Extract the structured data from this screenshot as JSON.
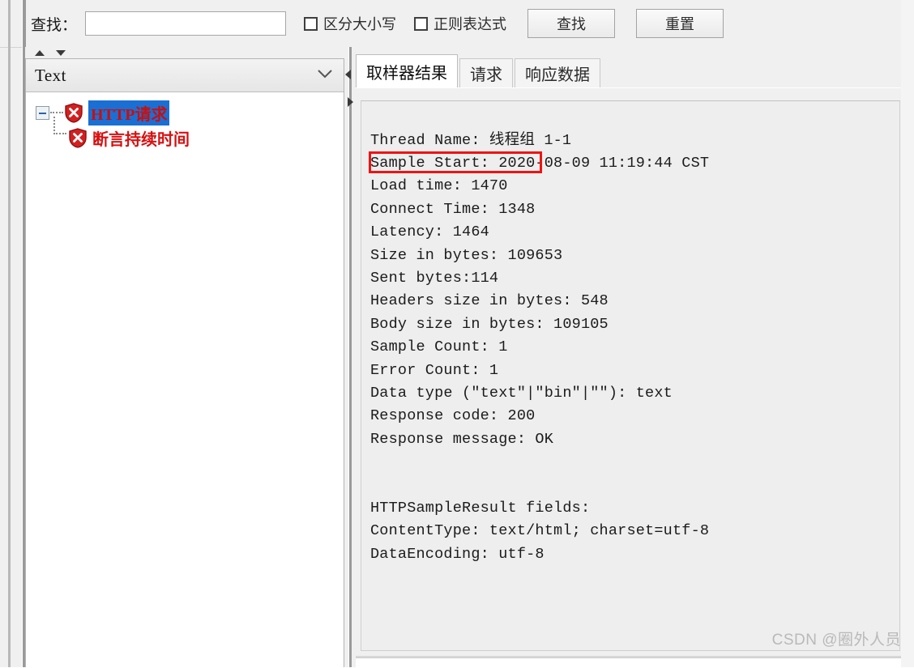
{
  "toolbar": {
    "search_label": "查找：",
    "search_value": "",
    "search_placeholder": "",
    "checkbox_case_sensitive": "区分大小写",
    "checkbox_regex": "正则表达式",
    "case_sensitive_checked": false,
    "regex_checked": false,
    "find_button": "查找",
    "reset_button": "重置"
  },
  "tree": {
    "type_selector_value": "Text",
    "chevron_icon": "chevron-down-icon",
    "nodes": [
      {
        "label": "HTTP请求",
        "icon": "error-shield-icon",
        "selected": true,
        "expanded": true
      },
      {
        "label": "断言持续时间",
        "icon": "error-shield-icon",
        "selected": false
      }
    ]
  },
  "splitter": {
    "up_arrow_icon": "triangle-up-icon",
    "down_arrow_icon": "triangle-down-icon",
    "left_arrow_icon": "triangle-left-icon",
    "right_arrow_icon": "triangle-right-icon"
  },
  "results": {
    "tabs": [
      {
        "label": "取样器结果",
        "active": true
      },
      {
        "label": "请求",
        "active": false
      },
      {
        "label": "响应数据",
        "active": false
      }
    ],
    "fields": {
      "thread_name": "Thread Name: 线程组 1-1",
      "sample_start": "Sample Start: 2020-08-09 11:19:44 CST",
      "load_time": "Load time: 1470",
      "connect_time": "Connect Time: 1348",
      "latency": "Latency: 1464",
      "size_in_bytes": "Size in bytes: 109653",
      "sent_bytes": "Sent bytes:114",
      "headers_size": "Headers size in bytes: 548",
      "body_size": "Body size in bytes: 109105",
      "sample_count": "Sample Count: 1",
      "error_count": "Error Count: 1",
      "data_type": "Data type (\"text\"|\"bin\"|\"\"): text",
      "response_code": "Response code: 200",
      "response_message": "Response message: OK",
      "fields_header": "HTTPSampleResult fields:",
      "content_type": "ContentType: text/html; charset=utf-8",
      "data_encoding": "DataEncoding: utf-8"
    },
    "body_text": "Thread Name: 线程组 1-1\nSample Start: 2020-08-09 11:19:44 CST\nLoad time: 1470\nConnect Time: 1348\nLatency: 1464\nSize in bytes: 109653\nSent bytes:114\nHeaders size in bytes: 548\nBody size in bytes: 109105\nSample Count: 1\nError Count: 1\nData type (\"text\"|\"bin\"|\"\"): text\nResponse code: 200\nResponse message: OK\n\n\nHTTPSampleResult fields:\nContentType: text/html; charset=utf-8\nDataEncoding: utf-8",
    "highlight_color": "#f01313",
    "highlighted_line": "Load time: 1470"
  },
  "watermark": {
    "text": "CSDN @圈外人员"
  },
  "colors": {
    "selection_blue": "#1a6fd4",
    "error_red": "#d81010",
    "panel_bg": "#f0f0f0",
    "text_area_bg": "#eeeeee"
  }
}
